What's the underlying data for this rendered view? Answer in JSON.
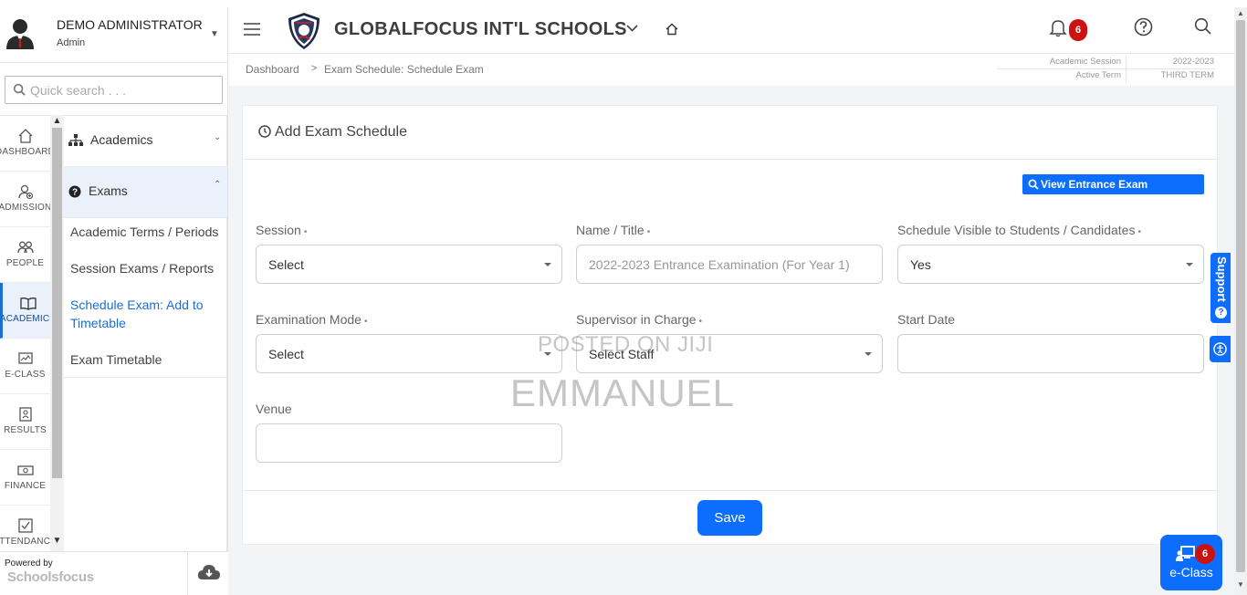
{
  "user": {
    "name": "DEMO ADMINISTRATOR",
    "role": "Admin"
  },
  "search": {
    "placeholder": "Quick search . . ."
  },
  "rail": [
    {
      "label": "DASHBOARD",
      "icon": "home-icon"
    },
    {
      "label": "ADMISSION",
      "icon": "user-plus-icon"
    },
    {
      "label": "PEOPLE",
      "icon": "people-icon"
    },
    {
      "label": "ACADEMICS",
      "icon": "book-icon"
    },
    {
      "label": "E-CLASS",
      "icon": "eclass-icon"
    },
    {
      "label": "RESULTS",
      "icon": "results-icon"
    },
    {
      "label": "FINANCE",
      "icon": "money-icon"
    },
    {
      "label": "ATTENDANCE",
      "icon": "checkbox-icon"
    }
  ],
  "submenu": {
    "academics": "Academics",
    "exams": "Exams",
    "links": [
      "Academic Terms / Periods",
      "Session Exams / Reports",
      "Schedule Exam: Add to Timetable",
      "Exam Timetable"
    ]
  },
  "footer": {
    "powered_by": "Powered by",
    "brand": "Schoolsfocus"
  },
  "topbar": {
    "school_name": "GLOBALFOCUS INT'L SCHOOLS",
    "notifications": "6"
  },
  "breadcrumb": {
    "home": "Dashboard",
    "separator": ">",
    "current": "Exam Schedule: Schedule Exam"
  },
  "session": {
    "session_label": "Academic Session",
    "session_value": "2022-2023",
    "term_label": "Active Term",
    "term_value": "THIRD TERM"
  },
  "form": {
    "title": "Add Exam Schedule",
    "view_button": "View Entrance Exam Schedules",
    "fields": {
      "session": {
        "label": "Session",
        "value": "Select"
      },
      "name": {
        "label": "Name / Title",
        "placeholder": "2022-2023 Entrance Examination (For Year 1)"
      },
      "visible": {
        "label": "Schedule Visible to Students / Candidates",
        "value": "Yes"
      },
      "mode": {
        "label": "Examination Mode",
        "value": "Select"
      },
      "supervisor": {
        "label": "Supervisor in Charge",
        "value": "Select Staff"
      },
      "start_date": {
        "label": "Start Date",
        "value": ""
      },
      "venue": {
        "label": "Venue",
        "value": ""
      }
    },
    "required_mark": "•",
    "save": "Save"
  },
  "watermark": {
    "line1": "POSTED ON JIJI",
    "line2": "EMMANUEL"
  },
  "floating": {
    "support": "Support",
    "support_q": "?",
    "eclass_label": "e-Class",
    "eclass_badge": "6"
  },
  "colors": {
    "primary": "#0d6efd",
    "badge": "#cc1111",
    "active_link": "#1a6fd6"
  }
}
